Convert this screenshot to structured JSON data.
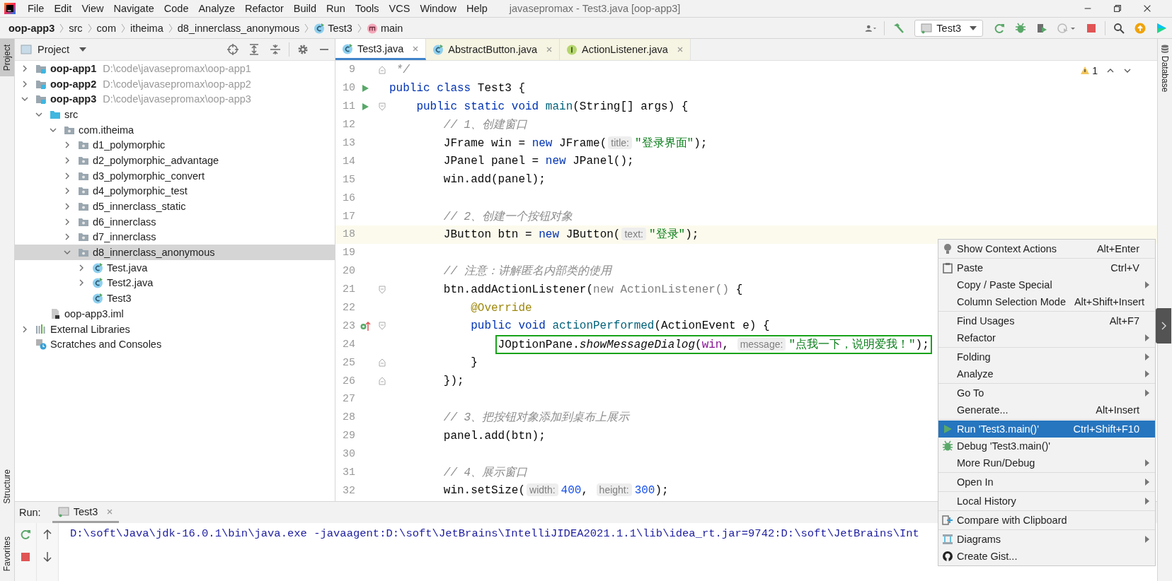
{
  "menu_bar": {
    "items": [
      "File",
      "Edit",
      "View",
      "Navigate",
      "Code",
      "Analyze",
      "Refactor",
      "Build",
      "Run",
      "Tools",
      "VCS",
      "Window",
      "Help"
    ],
    "title": "javasepromax - Test3.java [oop-app3]"
  },
  "breadcrumbs": [
    {
      "label": "oop-app3",
      "kind": "project"
    },
    {
      "label": "src",
      "kind": "dir"
    },
    {
      "label": "com",
      "kind": "dir"
    },
    {
      "label": "itheima",
      "kind": "dir"
    },
    {
      "label": "d8_innerclass_anonymous",
      "kind": "dir"
    },
    {
      "label": "Test3",
      "kind": "class"
    },
    {
      "label": "main",
      "kind": "method"
    }
  ],
  "run_configuration": {
    "label": "Test3"
  },
  "left_stripe": [
    {
      "label": "Project",
      "selected": true
    },
    {
      "label": "Structure",
      "selected": false
    },
    {
      "label": "Favorites",
      "selected": false
    }
  ],
  "project_panel": {
    "title": "Project",
    "tree": [
      {
        "label": "oop-app1",
        "path": "D:\\code\\javasepromax\\oop-app1",
        "kind": "module",
        "expanded": false,
        "selected": false
      },
      {
        "label": "oop-app2",
        "path": "D:\\code\\javasepromax\\oop-app2",
        "kind": "module",
        "expanded": false,
        "selected": false
      },
      {
        "label": "oop-app3",
        "path": "D:\\code\\javasepromax\\oop-app3",
        "kind": "module",
        "expanded": true,
        "selected": false,
        "children": [
          {
            "label": "src",
            "kind": "source",
            "expanded": true,
            "selected": false,
            "children": [
              {
                "label": "com.itheima",
                "kind": "package",
                "expanded": true,
                "selected": false,
                "children": [
                  {
                    "label": "d1_polymorphic",
                    "kind": "package",
                    "expanded": false,
                    "selected": false
                  },
                  {
                    "label": "d2_polymorphic_advantage",
                    "kind": "package",
                    "expanded": false,
                    "selected": false
                  },
                  {
                    "label": "d3_polymorphic_convert",
                    "kind": "package",
                    "expanded": false,
                    "selected": false
                  },
                  {
                    "label": "d4_polymorphic_test",
                    "kind": "package",
                    "expanded": false,
                    "selected": false
                  },
                  {
                    "label": "d5_innerclass_static",
                    "kind": "package",
                    "expanded": false,
                    "selected": false
                  },
                  {
                    "label": "d6_innerclass",
                    "kind": "package",
                    "expanded": false,
                    "selected": false
                  },
                  {
                    "label": "d7_innerclass",
                    "kind": "package",
                    "expanded": false,
                    "selected": false
                  },
                  {
                    "label": "d8_innerclass_anonymous",
                    "kind": "package",
                    "expanded": true,
                    "selected": true,
                    "children": [
                      {
                        "label": "Test.java",
                        "kind": "class",
                        "expanded": false,
                        "selected": false
                      },
                      {
                        "label": "Test2.java",
                        "kind": "class",
                        "expanded": false,
                        "selected": false
                      },
                      {
                        "label": "Test3",
                        "kind": "class",
                        "selected": false
                      }
                    ]
                  }
                ]
              }
            ]
          },
          {
            "label": "oop-app3.iml",
            "kind": "file",
            "selected": false
          }
        ]
      },
      {
        "label": "External Libraries",
        "kind": "libraries",
        "expanded": false,
        "selected": false
      },
      {
        "label": "Scratches and Consoles",
        "kind": "scratches",
        "selected": false
      }
    ]
  },
  "editor": {
    "tabs": [
      {
        "label": "Test3.java",
        "kind": "class",
        "selected": true,
        "library": false
      },
      {
        "label": "AbstractButton.java",
        "kind": "class",
        "selected": false,
        "library": true
      },
      {
        "label": "ActionListener.java",
        "kind": "interface",
        "selected": false,
        "library": true
      }
    ],
    "inspection_count": "1",
    "lines": [
      {
        "number": "9",
        "fold_end": true,
        "tokens": [
          {
            "kind": "comment",
            "text": " */"
          }
        ]
      },
      {
        "number": "10",
        "runnable": true,
        "tokens": [
          {
            "kind": "keyword",
            "text": "public class "
          },
          {
            "kind": "plain",
            "text": "Test3 {"
          }
        ]
      },
      {
        "number": "11",
        "runnable": true,
        "fold_start": true,
        "tokens": [
          {
            "kind": "keyword",
            "text": "    public static void "
          },
          {
            "kind": "method",
            "text": "main"
          },
          {
            "kind": "plain",
            "text": "(String[] args) {"
          }
        ]
      },
      {
        "number": "12",
        "tokens": [
          {
            "kind": "comment",
            "text": "        // 1、创建窗口"
          }
        ]
      },
      {
        "number": "13",
        "tokens": [
          {
            "kind": "plain",
            "text": "        JFrame win = "
          },
          {
            "kind": "keyword",
            "text": "new"
          },
          {
            "kind": "plain",
            "text": " JFrame("
          },
          {
            "kind": "hint",
            "text": "title:"
          },
          {
            "kind": "string",
            "text": "\"登录界面\""
          },
          {
            "kind": "plain",
            "text": ");"
          }
        ]
      },
      {
        "number": "14",
        "tokens": [
          {
            "kind": "plain",
            "text": "        JPanel panel = "
          },
          {
            "kind": "keyword",
            "text": "new"
          },
          {
            "kind": "plain",
            "text": " JPanel();"
          }
        ]
      },
      {
        "number": "15",
        "tokens": [
          {
            "kind": "plain",
            "text": "        win.add(panel);"
          }
        ]
      },
      {
        "number": "16"
      },
      {
        "number": "17",
        "tokens": [
          {
            "kind": "comment",
            "text": "        // 2、创建一个按钮对象"
          }
        ]
      },
      {
        "number": "18",
        "current": true,
        "tokens": [
          {
            "kind": "plain",
            "text": "        JButton btn = "
          },
          {
            "kind": "keyword",
            "text": "new"
          },
          {
            "kind": "plain",
            "text": " JButton("
          },
          {
            "kind": "hint",
            "text": "text:"
          },
          {
            "kind": "string",
            "text": "\"登录\""
          },
          {
            "kind": "plain",
            "text": ");"
          }
        ]
      },
      {
        "number": "19"
      },
      {
        "number": "20",
        "tokens": [
          {
            "kind": "comment",
            "text": "        // 注意：讲解匿名内部类的使用"
          }
        ]
      },
      {
        "number": "21",
        "fold_start": true,
        "tokens": [
          {
            "kind": "plain",
            "text": "        btn.addActionListener("
          },
          {
            "kind": "dim",
            "text": "new ActionListener()"
          },
          {
            "kind": "plain",
            "text": " {"
          }
        ]
      },
      {
        "number": "22",
        "tokens": [
          {
            "kind": "annotation",
            "text": "            @Override"
          }
        ]
      },
      {
        "number": "23",
        "implements": true,
        "fold_start": true,
        "tokens": [
          {
            "kind": "keyword",
            "text": "            public void "
          },
          {
            "kind": "method",
            "text": "actionPerformed"
          },
          {
            "kind": "plain",
            "text": "(ActionEvent e) {"
          }
        ]
      },
      {
        "number": "24",
        "boxed": true,
        "tokens": [
          {
            "kind": "plain",
            "text": "                JOptionPane."
          },
          {
            "kind": "static",
            "text": "showMessageDialog"
          },
          {
            "kind": "plain",
            "text": "("
          },
          {
            "kind": "param",
            "text": "win"
          },
          {
            "kind": "plain",
            "text": ", "
          },
          {
            "kind": "hint",
            "text": "message:"
          },
          {
            "kind": "string",
            "text": "\"点我一下，说明爱我！\""
          },
          {
            "kind": "plain",
            "text": ");"
          }
        ]
      },
      {
        "number": "25",
        "fold_end": true,
        "tokens": [
          {
            "kind": "plain",
            "text": "            }"
          }
        ]
      },
      {
        "number": "26",
        "fold_end": true,
        "tokens": [
          {
            "kind": "plain",
            "text": "        });"
          }
        ]
      },
      {
        "number": "27"
      },
      {
        "number": "28",
        "tokens": [
          {
            "kind": "comment",
            "text": "        // 3、把按钮对象添加到桌布上展示"
          }
        ]
      },
      {
        "number": "29",
        "tokens": [
          {
            "kind": "plain",
            "text": "        panel.add(btn);"
          }
        ]
      },
      {
        "number": "30"
      },
      {
        "number": "31",
        "tokens": [
          {
            "kind": "comment",
            "text": "        // 4、展示窗口"
          }
        ]
      },
      {
        "number": "32",
        "tokens": [
          {
            "kind": "plain",
            "text": "        win.setSize("
          },
          {
            "kind": "hint",
            "text": "width:"
          },
          {
            "kind": "number",
            "text": "400"
          },
          {
            "kind": "plain",
            "text": ", "
          },
          {
            "kind": "hint",
            "text": "height:"
          },
          {
            "kind": "number",
            "text": "300"
          },
          {
            "kind": "plain",
            "text": ");"
          }
        ]
      }
    ]
  },
  "right_stripe": [
    {
      "label": "Database"
    }
  ],
  "run_panel": {
    "label": "Run:",
    "tabs": [
      {
        "label": "Test3",
        "selected": true
      }
    ],
    "console": [
      "D:\\soft\\Java\\jdk-16.0.1\\bin\\java.exe -javaagent:D:\\soft\\JetBrains\\IntelliJIDEA2021.1.1\\lib\\idea_rt.jar=9742:D:\\soft\\JetBrains\\Int"
    ]
  },
  "context_menu": {
    "groups": [
      [
        {
          "label": "Show Context Actions",
          "shortcut": "Alt+Enter",
          "kind": "bulb",
          "submenu": false,
          "selected": false
        }
      ],
      [
        {
          "label": "Paste",
          "shortcut": "Ctrl+V",
          "kind": "clipboard",
          "submenu": false,
          "selected": false
        },
        {
          "label": "Copy / Paste Special",
          "submenu": true,
          "selected": false
        },
        {
          "label": "Column Selection Mode",
          "shortcut": "Alt+Shift+Insert",
          "submenu": false,
          "selected": false
        }
      ],
      [
        {
          "label": "Find Usages",
          "shortcut": "Alt+F7",
          "submenu": false,
          "selected": false
        },
        {
          "label": "Refactor",
          "submenu": true,
          "selected": false
        }
      ],
      [
        {
          "label": "Folding",
          "submenu": true,
          "selected": false
        },
        {
          "label": "Analyze",
          "submenu": true,
          "selected": false
        }
      ],
      [
        {
          "label": "Go To",
          "submenu": true,
          "selected": false
        },
        {
          "label": "Generate...",
          "shortcut": "Alt+Insert",
          "submenu": false,
          "selected": false
        }
      ],
      [
        {
          "label": "Run 'Test3.main()'",
          "shortcut": "Ctrl+Shift+F10",
          "kind": "run",
          "submenu": false,
          "selected": true
        },
        {
          "label": "Debug 'Test3.main()'",
          "kind": "bug",
          "submenu": false,
          "selected": false
        },
        {
          "label": "More Run/Debug",
          "submenu": true,
          "selected": false
        }
      ],
      [
        {
          "label": "Open In",
          "submenu": true,
          "selected": false
        }
      ],
      [
        {
          "label": "Local History",
          "submenu": true,
          "selected": false
        }
      ],
      [
        {
          "label": "Compare with Clipboard",
          "kind": "compare",
          "submenu": false,
          "selected": false
        }
      ],
      [
        {
          "label": "Diagrams",
          "kind": "diagram",
          "submenu": true,
          "selected": false
        },
        {
          "label": "Create Gist...",
          "kind": "github",
          "submenu": false,
          "selected": false
        }
      ]
    ]
  }
}
